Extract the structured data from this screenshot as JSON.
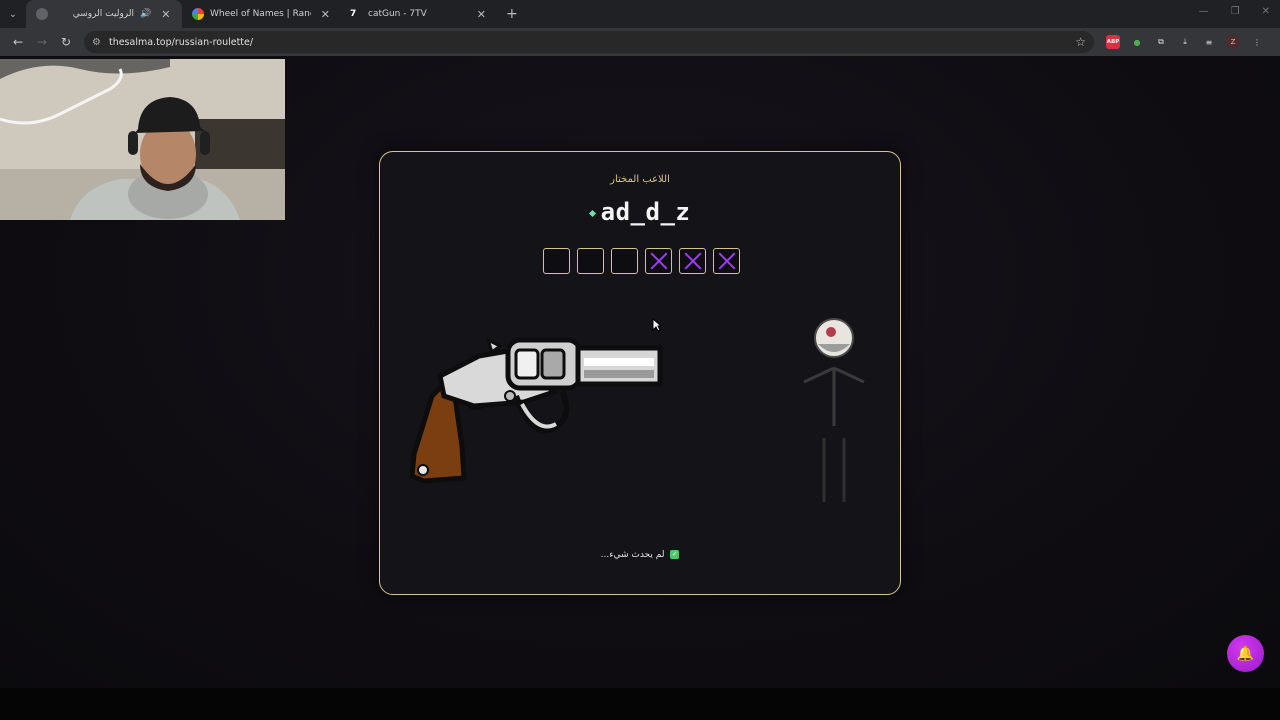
{
  "tabs": [
    {
      "title": "الروليت الروسي",
      "active": true,
      "icon_color": "#5f6368",
      "audio": true
    },
    {
      "title": "Wheel of Names | Random nam",
      "active": false,
      "icon_color": "#e94335"
    },
    {
      "title": "catGun - 7TV",
      "active": false,
      "icon_color": "#ffffff"
    }
  ],
  "toolbar": {
    "url": "thesalma.top/russian-roulette/",
    "extensions": [
      "ABP",
      "green-leaf-icon",
      "puzzle-icon"
    ],
    "profile_initial": "Z"
  },
  "game": {
    "selected_label": "اللاعب المختار",
    "player_name": "ad_d_z",
    "chambers": [
      "loaded",
      "loaded",
      "loaded",
      "empty",
      "empty",
      "empty"
    ],
    "status_text": "لم يحدث شيء...",
    "status_check": "✓"
  },
  "colors": {
    "card_border": "#d6c58a",
    "empty_mark": "#9b3df0",
    "status_ok": "#4cc864",
    "fab": "#c02ae0"
  }
}
